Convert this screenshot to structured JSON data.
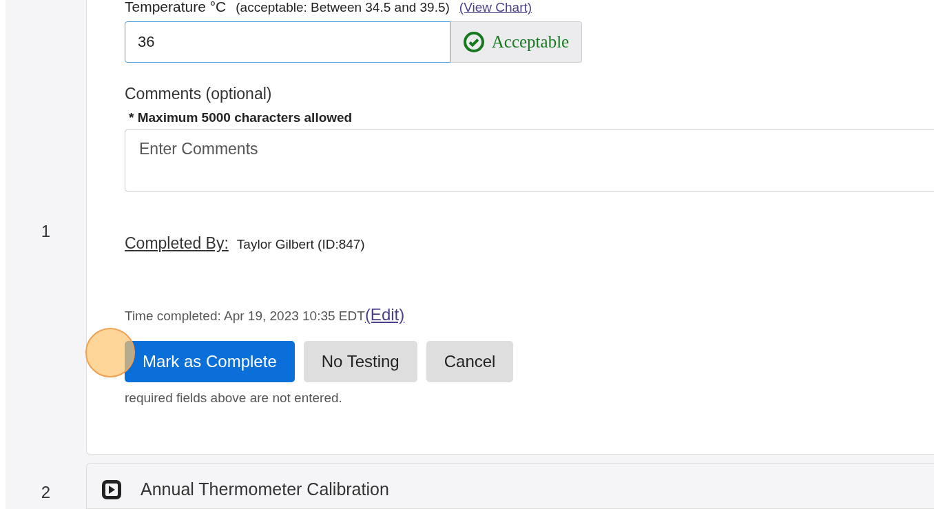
{
  "steps": [
    {
      "number": "1",
      "kind": "form",
      "expanded": true,
      "temperature": {
        "label": "Temperature °C",
        "range": "(acceptable: Between 34.5 and 39.5)",
        "chart_link": "(View Chart)",
        "value": "36",
        "status": "Acceptable"
      },
      "comments": {
        "label": "Comments (optional)",
        "note": "* Maximum 5000 characters allowed",
        "placeholder": "Enter Comments"
      },
      "completed_by": {
        "label": "Completed By:",
        "value": "Taylor Gilbert (ID:847)"
      },
      "time_completed": {
        "text": "Time completed: Apr 19, 2023 10:35 EDT",
        "edit_link": "(Edit)"
      },
      "buttons": [
        {
          "label": "Mark as Complete",
          "kind": "primary"
        },
        {
          "label": "No Testing",
          "kind": "secondary"
        },
        {
          "label": "Cancel",
          "kind": "secondary"
        }
      ],
      "message": "required fields above are not entered."
    },
    {
      "number": "2",
      "kind": "collapsed",
      "expanded": false,
      "title": "Annual Thermometer Calibration"
    }
  ]
}
